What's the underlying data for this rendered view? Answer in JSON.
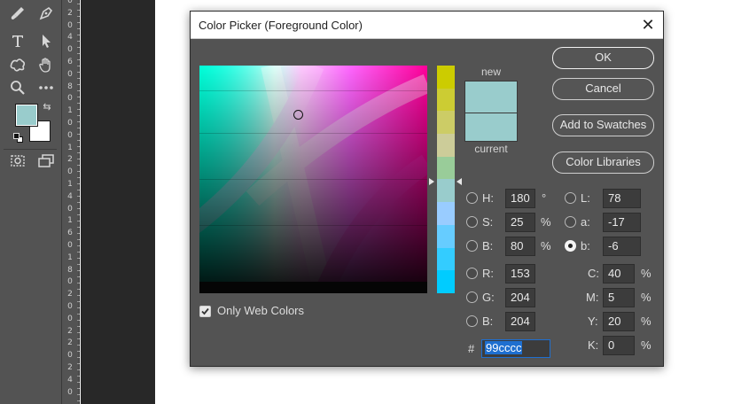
{
  "ruler": {
    "labels": [
      "0",
      "2",
      "0",
      "4",
      "0",
      "6",
      "0",
      "8",
      "0",
      "1",
      "0",
      "0",
      "1",
      "2",
      "0",
      "1",
      "4",
      "0",
      "1",
      "6",
      "0",
      "1",
      "8",
      "0",
      "2",
      "0",
      "0",
      "2",
      "2",
      "0",
      "2",
      "4",
      "0"
    ]
  },
  "dialog": {
    "title": "Color Picker (Foreground Color)",
    "close_glyph": "✕",
    "new_label": "new",
    "current_label": "current",
    "new_color": "#99cccc",
    "current_color": "#99cccc",
    "buttons": {
      "ok": "OK",
      "cancel": "Cancel",
      "add_to_swatches": "Add to Swatches",
      "color_libraries": "Color Libraries"
    },
    "hsb": {
      "h": {
        "label": "H:",
        "value": "180",
        "unit": "°"
      },
      "s": {
        "label": "S:",
        "value": "25",
        "unit": "%"
      },
      "b": {
        "label": "B:",
        "value": "80",
        "unit": "%"
      }
    },
    "rgb": {
      "r": {
        "label": "R:",
        "value": "153"
      },
      "g": {
        "label": "G:",
        "value": "204"
      },
      "b": {
        "label": "B:",
        "value": "204"
      }
    },
    "lab": {
      "l": {
        "label": "L:",
        "value": "78"
      },
      "a": {
        "label": "a:",
        "value": "-17"
      },
      "b": {
        "label": "b:",
        "value": "-6",
        "selected": true
      }
    },
    "cmyk": {
      "c": {
        "label": "C:",
        "value": "40",
        "unit": "%"
      },
      "m": {
        "label": "M:",
        "value": "5",
        "unit": "%"
      },
      "y": {
        "label": "Y:",
        "value": "20",
        "unit": "%"
      },
      "k": {
        "label": "K:",
        "value": "0",
        "unit": "%"
      }
    },
    "hex": {
      "hash": "#",
      "value": "99cccc"
    },
    "only_web_colors": {
      "label": "Only Web Colors",
      "checked": true
    },
    "hue_strip_colors": [
      "#cccc00",
      "#cccc33",
      "#cccc66",
      "#cccc99",
      "#99cc99",
      "#99cccc",
      "#99ccff",
      "#66ccff",
      "#33ccff",
      "#00ccff"
    ]
  },
  "colors": {
    "foreground_swatch": "#99cccc",
    "background_swatch": "#ffffff",
    "accent": "#1e6fd0"
  }
}
